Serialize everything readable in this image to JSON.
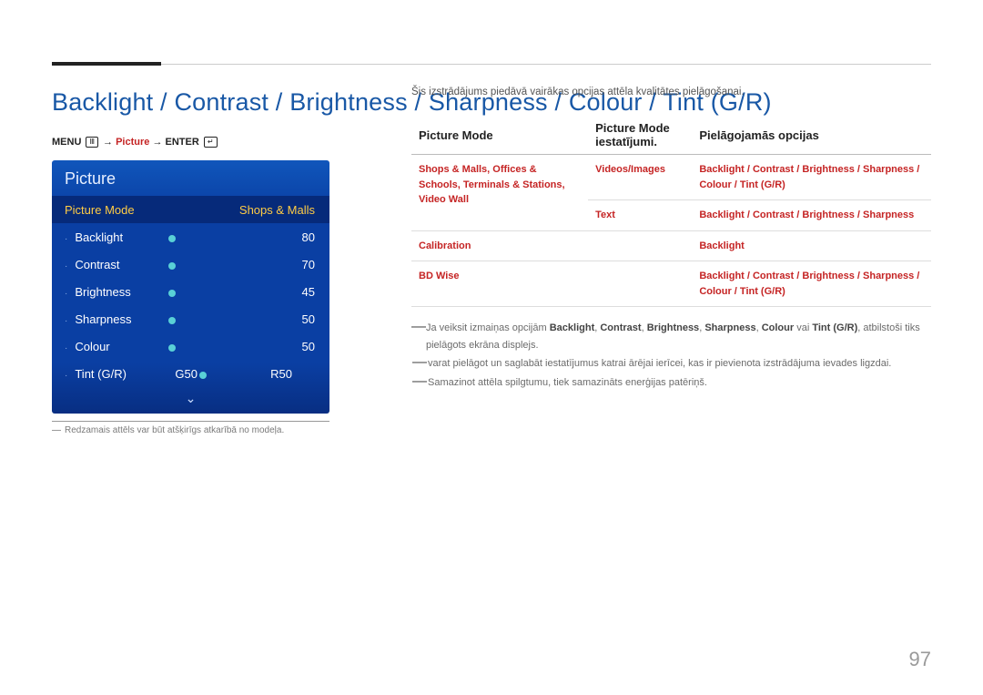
{
  "title": "Backlight / Contrast / Brightness / Sharpness / Colour / Tint (G/R)",
  "nav": {
    "pre": "MENU",
    "path1": "Picture",
    "post": "ENTER"
  },
  "osd": {
    "header": "Picture",
    "picture_mode": {
      "label": "Picture Mode",
      "value": "Shops & Malls"
    },
    "rows": [
      {
        "label": "Backlight",
        "value": "80",
        "pct": 80
      },
      {
        "label": "Contrast",
        "value": "70",
        "pct": 70
      },
      {
        "label": "Brightness",
        "value": "45",
        "pct": 45
      },
      {
        "label": "Sharpness",
        "value": "50",
        "pct": 50
      },
      {
        "label": "Colour",
        "value": "50",
        "pct": 50
      }
    ],
    "tint": {
      "label": "Tint (G/R)",
      "left": "G50",
      "right": "R50"
    }
  },
  "caption": "Redzamais attēls var būt atšķirīgs atkarībā no modeļa.",
  "intro": "Šis izstrādājums piedāvā vairākas opcijas attēla kvalitātes pielāgošanai.",
  "table": {
    "headers": [
      "Picture Mode",
      "Picture Mode iestatījumi.",
      "Pielāgojamās opcijas"
    ],
    "rows": [
      {
        "c1": "Shops & Malls, Offices & Schools, Terminals & Stations, Video Wall",
        "c2": "Videos/Images",
        "c3": "Backlight / Contrast / Brightness / Sharpness / Colour / Tint (G/R)"
      },
      {
        "c1": "",
        "c2": "Text",
        "c3": "Backlight / Contrast / Brightness / Sharpness"
      },
      {
        "c1": "Calibration",
        "c2": "",
        "c3": "Backlight"
      },
      {
        "c1": "BD Wise",
        "c2": "",
        "c3": "Backlight / Contrast / Brightness / Sharpness / Colour / Tint (G/R)"
      }
    ]
  },
  "notes": {
    "n1a": "Ja veiksit izmaiņas opcijām ",
    "n1b": " vai ",
    "n1c": ", atbilstoši tiks pielāgots ekrāna displejs.",
    "bold": [
      "Backlight",
      "Contrast",
      "Brightness",
      "Sharpness",
      "Colour",
      "Tint (G/R)"
    ],
    "n2": "varat pielāgot un saglabāt iestatījumus katrai ārējai ierīcei, kas ir pievienota izstrādājuma ievades ligzdai.",
    "n3": "Samazinot attēla spilgtumu, tiek samazināts enerģijas patēriņš."
  },
  "page_number": "97"
}
